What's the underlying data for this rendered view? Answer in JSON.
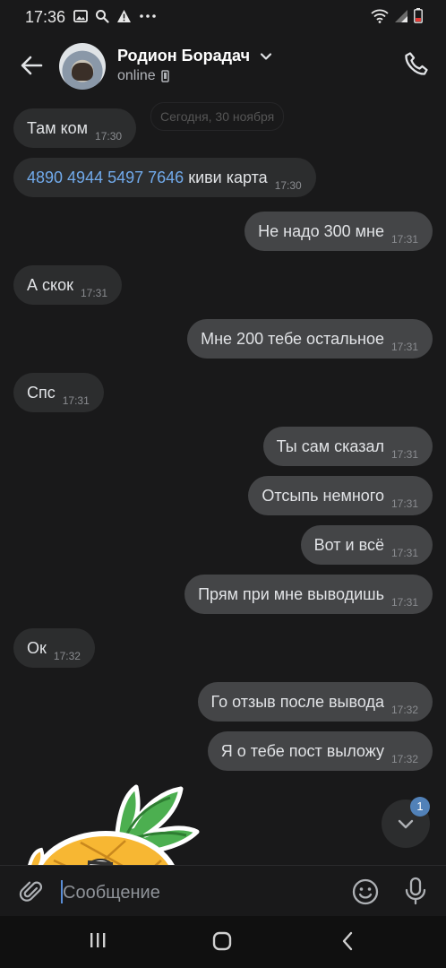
{
  "status_bar": {
    "time": "17:36",
    "left_icons": [
      "image-icon",
      "search-icon",
      "warning-icon",
      "more-icon"
    ],
    "right_icons": [
      "wifi-icon",
      "signal-icon",
      "battery-icon"
    ]
  },
  "header": {
    "contact_name": "Родион Борадач",
    "presence": "online"
  },
  "chat": {
    "date_label": "Сегодня, 30 ноября",
    "messages": [
      {
        "dir": "in",
        "text": "Там ком",
        "time": "17:30"
      },
      {
        "dir": "in",
        "link": "4890 4944 5497 7646",
        "text": " киви карта",
        "time": "17:30"
      },
      {
        "dir": "out",
        "text": "Не надо 300 мне",
        "time": "17:31"
      },
      {
        "dir": "in",
        "text": "А скок",
        "time": "17:31"
      },
      {
        "dir": "out",
        "text": "Мне 200 тебе остальное",
        "time": "17:31"
      },
      {
        "dir": "in",
        "text": "Спс",
        "time": "17:31"
      },
      {
        "dir": "out",
        "text": "Ты сам сказал",
        "time": "17:31"
      },
      {
        "dir": "out",
        "text": "Отсыпь немного",
        "time": "17:31"
      },
      {
        "dir": "out",
        "text": "Вот и всё",
        "time": "17:31"
      },
      {
        "dir": "out",
        "text": "Прям при мне выводишь",
        "time": "17:31"
      },
      {
        "dir": "in",
        "text": "Ок",
        "time": "17:32"
      },
      {
        "dir": "out",
        "text": "Го отзыв после вывода",
        "time": "17:32"
      },
      {
        "dir": "out",
        "text": "Я о тебе пост выложу",
        "time": "17:32"
      }
    ],
    "unread_badge": "1"
  },
  "composer": {
    "placeholder": "Сообщение"
  },
  "colors": {
    "background": "#19191a",
    "incoming_bubble": "#2c2d2e",
    "outgoing_bubble": "#444547",
    "link": "#71aaeb",
    "badge": "#5181b8"
  }
}
